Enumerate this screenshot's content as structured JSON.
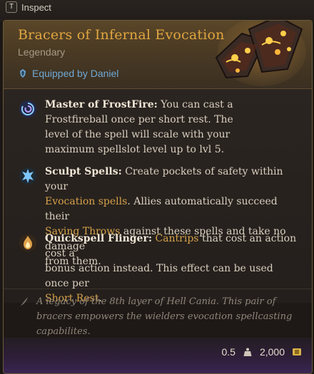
{
  "topbar": {
    "inspect_key": "T",
    "inspect_label": "Inspect"
  },
  "item": {
    "title": "Bracers of Infernal Evocation",
    "rarity": "Legendary",
    "equipped_by": "Equipped by Daniel"
  },
  "passives": [
    {
      "icon": "frost-spiral-icon",
      "name": "Master of FrostFire:",
      "text_lines": [
        "You can cast a",
        "Frostfireball once per short rest.  The",
        "level of the spell will scale with your",
        "maximum spellslot level up to lvl 5."
      ]
    },
    {
      "icon": "sculpt-spells-icon",
      "name": "Sculpt Spells:",
      "text_a": "Create pockets of safety within your",
      "highlight_a": "Evocation spells",
      "text_b": ". Allies automatically succeed their",
      "highlight_b": "Saving Throws",
      "text_c": "against these spells and take no damage",
      "text_d": "from them."
    },
    {
      "icon": "quickspell-flinger-icon",
      "name": "Quickspell Flinger:",
      "highlight_a": "Cantrips",
      "text_a": "that cost an action cost a",
      "text_b": "bonus action instead. This effect can be used once per",
      "highlight_b": "Short Rest",
      "text_c": "."
    }
  ],
  "flavor": {
    "text": "A legacy of the 8th layer of Hell Cania. This pair of bracers empowers the wielders evocation spellcasting capabilites."
  },
  "footer": {
    "weight": "0.5",
    "price": "2,000"
  },
  "colors": {
    "title": "#e0a640",
    "highlight": "#d6a24a",
    "equipped": "#6fa9d6",
    "text": "#d9cfbf"
  }
}
